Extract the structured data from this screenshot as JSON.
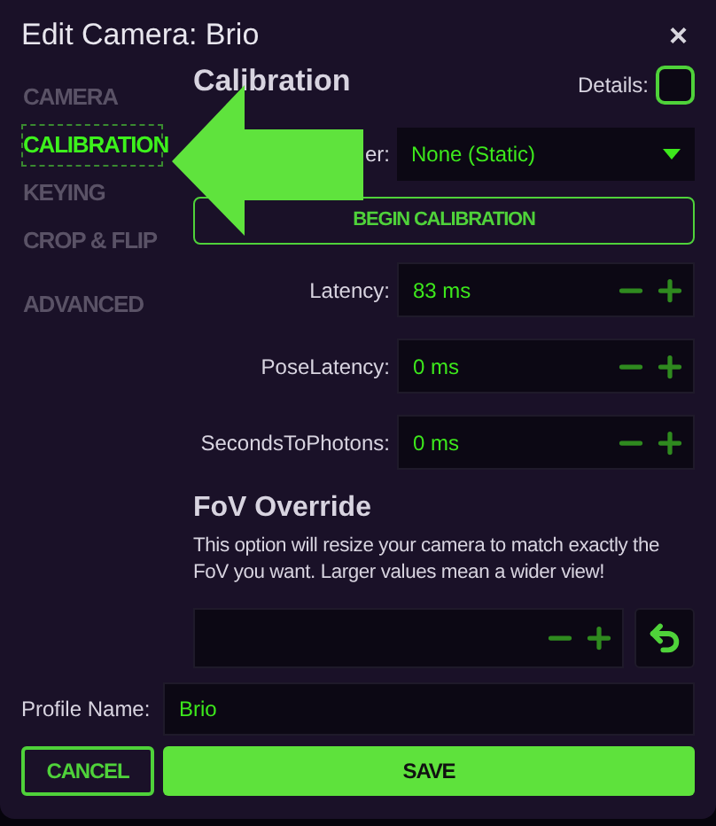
{
  "window": {
    "title": "Edit Camera: Brio",
    "close": "×"
  },
  "sidebar": {
    "groups": [
      [
        {
          "label": "CAMERA",
          "selected": false
        },
        {
          "label": "CALIBRATION",
          "selected": true
        },
        {
          "label": "KEYING",
          "selected": false
        },
        {
          "label": "CROP & FLIP",
          "selected": false
        }
      ],
      [
        {
          "label": "ADVANCED",
          "selected": false
        }
      ]
    ]
  },
  "calibration": {
    "heading": "Calibration",
    "details": {
      "label": "Details:",
      "checked": false
    },
    "tracker": {
      "label": "er:",
      "value": "None (Static)"
    },
    "begin_button": "BEGIN CALIBRATION",
    "fields": [
      {
        "label": "Latency:",
        "value": "83 ms"
      },
      {
        "label": "PoseLatency:",
        "value": "0 ms"
      },
      {
        "label": "SecondsToPhotons:",
        "value": "0 ms"
      }
    ]
  },
  "fov": {
    "heading": "FoV Override",
    "description": "This option will resize your camera to match exactly the FoV you want. Larger values mean a wider view!"
  },
  "profile": {
    "label": "Profile Name:",
    "value": "Brio"
  },
  "buttons": {
    "cancel": "CANCEL",
    "save": "SAVE"
  }
}
